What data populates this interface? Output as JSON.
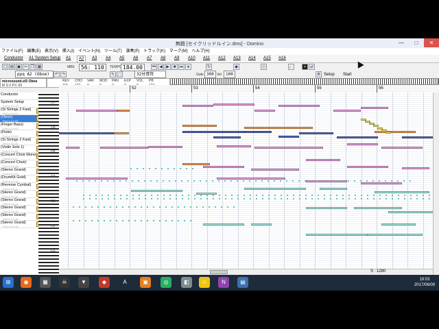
{
  "window": {
    "title": "無題 [セイクリッドルイン.dms] - Domino",
    "minimize": "—",
    "maximize": "□",
    "close": "✕"
  },
  "menu": [
    "ファイル(F)",
    "編集(E)",
    "表示(V)",
    "挿入(I)",
    "イベント(N)",
    "ツール(T)",
    "演奏(P)",
    "トラック(K)",
    "マーク(M)",
    "ヘルプ(H)"
  ],
  "tabs": [
    "Conductor",
    "A1 System Setup",
    "A1",
    "A2",
    "A3",
    "A4",
    "A5",
    "A6",
    "A7",
    "A8",
    "A9",
    "A10",
    "A11",
    "A12",
    "A13",
    "A14",
    "A15",
    "A16"
  ],
  "selected_tab": "A2",
  "toolbar": {
    "pos_label": "MBE",
    "position": "56: 110",
    "tempo_label": "TEMPO",
    "tempo": "184.00",
    "setup_label": "Setup",
    "start_label": "Start",
    "track_select": "ppq A2 (Oboe)",
    "grid_select": "32分音符",
    "gate_label": "Gate",
    "gate_value": "300",
    "vel_label": "Vel",
    "vel_value": "100"
  },
  "track_header": {
    "sound": "microsound.sf2 Oboe",
    "row": "M  S  0  P.C  69"
  },
  "mixer": {
    "labels": [
      "REV",
      "CHO",
      "VAR",
      "MOD",
      "PAN",
      "EXP",
      "VOL",
      "PB"
    ],
    "values": [
      "115",
      "127",
      "0",
      "0",
      "0",
      "0",
      "0",
      "127"
    ]
  },
  "tracks": [
    {
      "name": "Conductor",
      "sub": ""
    },
    {
      "name": "System Setup",
      "sub": "Port A  Ch.10"
    },
    {
      "name": "(St Strings 2 Fast)",
      "sub": "Port A  Ch.01"
    },
    {
      "name": "(Oboe)",
      "sub": "Port A  Ch.02"
    },
    {
      "name": "(Finger Bass)",
      "sub": "Port A  Ch.03"
    },
    {
      "name": "(Flute)",
      "sub": "Port A  Ch.04"
    },
    {
      "name": "(St Strings 2 Fast)",
      "sub": "Port A  Ch.05"
    },
    {
      "name": "(Violin Solo 1)",
      "sub": "Port A  Ch.06"
    },
    {
      "name": "(Concert Choir Mono)",
      "sub": "Port A  Ch.07"
    },
    {
      "name": "(Concert Choir)",
      "sub": "Port A  Ch.08"
    },
    {
      "name": "(Stereo Grand)",
      "sub": "Port A  Ch.09"
    },
    {
      "name": "(DrumKit Gold)",
      "sub": "Port A  Ch.10"
    },
    {
      "name": "(Reverse Cymbal)",
      "sub": "Port A  Ch.11"
    },
    {
      "name": "(Stereo Grand)",
      "sub": "Port A  Ch.12"
    },
    {
      "name": "(Stereo Grand)",
      "sub": "Port A  Ch.13"
    },
    {
      "name": "(Stereo Grand)",
      "sub": "Port A  Ch.14"
    },
    {
      "name": "(Stereo Grand)",
      "sub": "Port A  Ch.15"
    },
    {
      "name": "(Stereo Grand)",
      "sub": "Port A  Ch.16"
    }
  ],
  "selected_track": 3,
  "bars": [
    "52",
    "53",
    "54",
    "55",
    "56"
  ],
  "octaves": [
    "O7",
    "O6",
    "O5",
    "O4",
    "O3",
    "O2",
    "O1"
  ],
  "status": "S : 1280",
  "taskbar": {
    "time": "19:03",
    "date": "2017/06/09"
  }
}
